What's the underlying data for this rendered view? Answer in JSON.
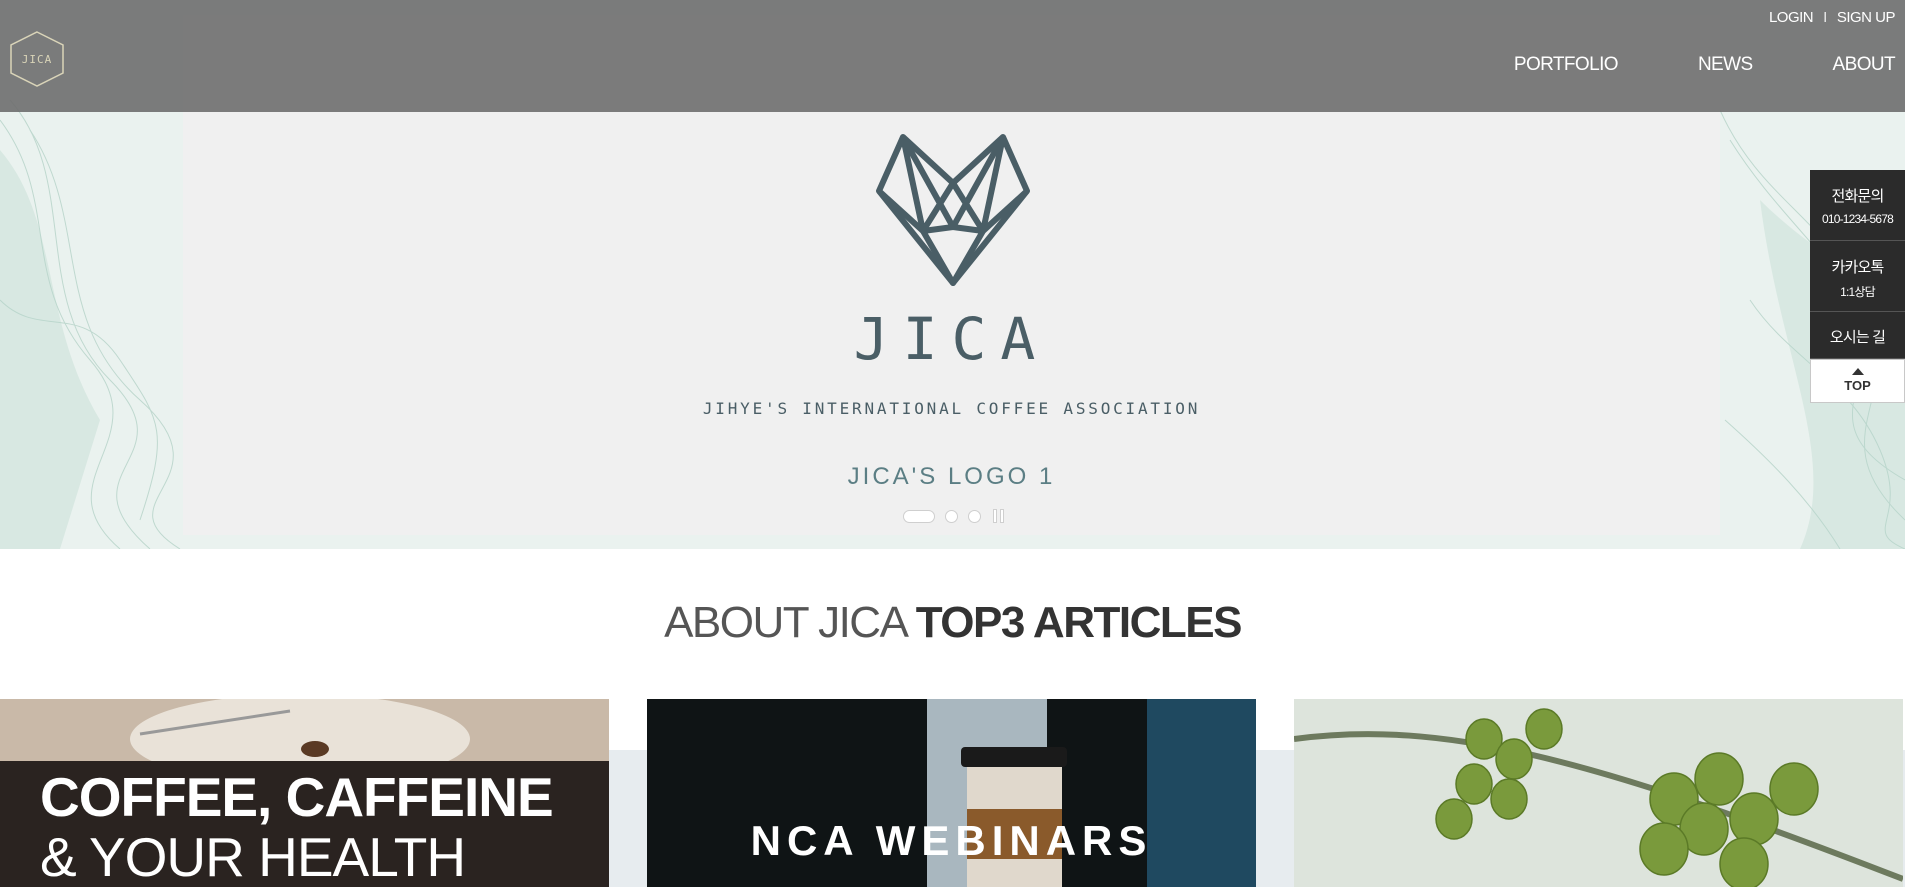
{
  "brand": {
    "logo_text": "JICA"
  },
  "header": {
    "util": {
      "login": "LOGIN",
      "separator": "I",
      "signup": "SIGN UP"
    },
    "nav": [
      {
        "label": "PORTFOLIO"
      },
      {
        "label": "NEWS"
      },
      {
        "label": "ABOUT"
      }
    ]
  },
  "hero": {
    "title": "JICA",
    "subtitle": "JIHYE'S INTERNATIONAL COFFEE ASSOCIATION",
    "caption": "JICA'S LOGO 1",
    "pager": {
      "total_slides": 3,
      "active_slide": 1,
      "control_icon": "pause-icon"
    }
  },
  "quick_menu": {
    "phone": {
      "label": "전화문의",
      "value": "010-1234-5678"
    },
    "kakao": {
      "label": "카카오톡",
      "value": "1:1상담"
    },
    "directions": {
      "label": "오시는 길"
    },
    "top": {
      "label": "TOP"
    }
  },
  "articles": {
    "heading_light": "ABOUT JICA ",
    "heading_bold": "TOP3 ARTICLES",
    "cards": [
      {
        "line1": "COFFEE, CAFFEINE",
        "line2": "& YOUR HEALTH"
      },
      {
        "text": "NCA WEBINARS"
      },
      {
        "image": "green-coffee-beans"
      }
    ]
  },
  "colors": {
    "topbar": "#6e6e6e",
    "slide_bg": "#f0f0f0",
    "emblem": "#4a5e66",
    "caption": "#5b7e84",
    "quick_bg": "#2b2b2b"
  }
}
